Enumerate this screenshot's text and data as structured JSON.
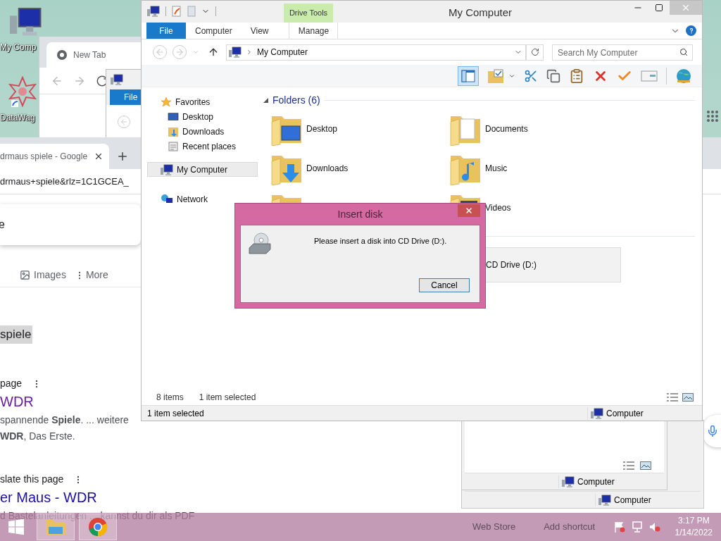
{
  "desktop_icons": [
    {
      "label": "My Comp",
      "kind": "computer"
    },
    {
      "label": "DataWag",
      "kind": "app"
    }
  ],
  "back_browser": {
    "tab": "New Tab"
  },
  "back_explorer": {
    "ribbon_tab": "File"
  },
  "browser": {
    "tab": "drmaus spiele - Google",
    "url": "drmaus+spiele&rlz=1C1GCEA_",
    "query": "e",
    "search_tabs": [
      {
        "label": "Images",
        "kind": "images"
      },
      {
        "label": "More",
        "kind": "more"
      }
    ],
    "highlight": "spiele",
    "results": [
      {
        "source": "page",
        "title": "WDR",
        "visited": true,
        "snippet": [
          "spannende **Spiele**. ... weitere",
          "**WDR**, Das Erste."
        ]
      },
      {
        "source": "slate this page",
        "title": "er Maus - WDR",
        "visited": false,
        "snippet": [
          "d Bastelanleitungen ... kannst du dir als PDF"
        ]
      }
    ],
    "bookmarks": [
      "Web Store",
      "Add shortcut"
    ]
  },
  "explorer": {
    "title": "My Computer",
    "context_tab": "Drive Tools",
    "ribbon_tabs": [
      {
        "label": "File",
        "kind": "file",
        "selected": false
      },
      {
        "label": "Computer",
        "kind": "plain",
        "selected": false
      },
      {
        "label": "View",
        "kind": "plain",
        "selected": false
      },
      {
        "label": "Manage",
        "kind": "context",
        "selected": false
      }
    ],
    "address": "My Computer",
    "search_placeholder": "Search My Computer",
    "nav": [
      {
        "label": "Favorites",
        "kind": "favorites",
        "selected": false,
        "children": [
          {
            "label": "Desktop",
            "kind": "desktop",
            "selected": false
          },
          {
            "label": "Downloads",
            "kind": "downloads",
            "selected": false
          },
          {
            "label": "Recent places",
            "kind": "recent",
            "selected": false
          }
        ]
      },
      {
        "label": "My Computer",
        "kind": "computer",
        "selected": true
      },
      {
        "label": "Network",
        "kind": "network",
        "selected": false
      }
    ],
    "section": {
      "label": "Folders (6)",
      "expanded": true
    },
    "folders": [
      {
        "label": "Desktop",
        "kind": "desktop"
      },
      {
        "label": "Documents",
        "kind": "documents"
      },
      {
        "label": "Downloads",
        "kind": "downloads"
      },
      {
        "label": "Music",
        "kind": "music"
      },
      {
        "kind": "plain"
      },
      {
        "label": "Videos",
        "kind": "videos"
      }
    ],
    "drives": [
      {
        "label": "CD Drive (D:)",
        "selected": true
      }
    ],
    "status_items": "8 items",
    "status_selected": "1 item selected",
    "bottom_status": "1 item selected",
    "bottom_location": "Computer"
  },
  "dialog": {
    "title": "Insert disk",
    "message": "Please insert a disk into CD Drive (D:).",
    "button": "Cancel"
  },
  "back_windows": [
    {
      "status": "Computer"
    },
    {
      "status": "Computer"
    }
  ],
  "taskbar": {
    "time": "3:17 PM",
    "date": "1/14/2022"
  }
}
